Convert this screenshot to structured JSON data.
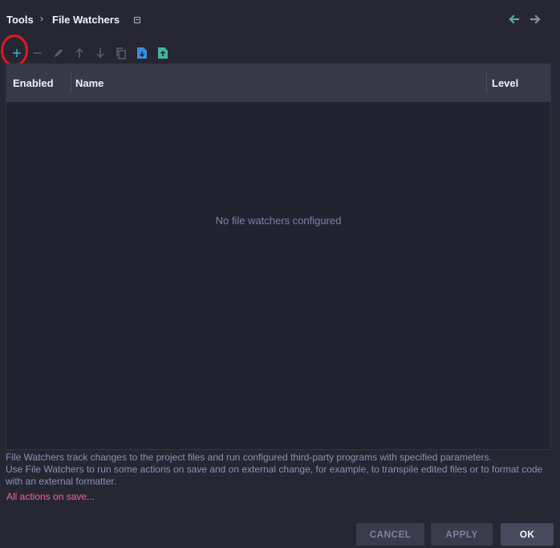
{
  "header": {
    "breadcrumb": [
      "Tools",
      "File Watchers"
    ],
    "separator": "›"
  },
  "toolbar": {
    "buttons": [
      {
        "name": "add-icon",
        "color": "#3fb5c6"
      },
      {
        "name": "remove-icon",
        "color": "#5a5d6c"
      },
      {
        "name": "edit-icon",
        "color": "#5f6270"
      },
      {
        "name": "move-up-icon",
        "color": "#5f6270"
      },
      {
        "name": "move-down-icon",
        "color": "#5f6270"
      },
      {
        "name": "copy-icon",
        "color": "#5f6270"
      },
      {
        "name": "import-icon",
        "color": "#3b8de0"
      },
      {
        "name": "export-icon",
        "color": "#42b79b"
      }
    ]
  },
  "table": {
    "columns": [
      "Enabled",
      "Name",
      "Level"
    ],
    "empty_text": "No file watchers configured"
  },
  "description": [
    "File Watchers track changes to the project files and run configured third-party programs with specified parameters.",
    "Use File Watchers to run some actions on save and on external change, for example, to transpile edited files or to format code with an external formatter."
  ],
  "link": "All actions on save...",
  "buttons": {
    "cancel": "CANCEL",
    "apply": "APPLY",
    "ok": "OK"
  },
  "colors": {
    "background": "#262733",
    "accent": "#3fb5c6",
    "link": "#ff5fa2",
    "highlight": "#e0191f"
  }
}
